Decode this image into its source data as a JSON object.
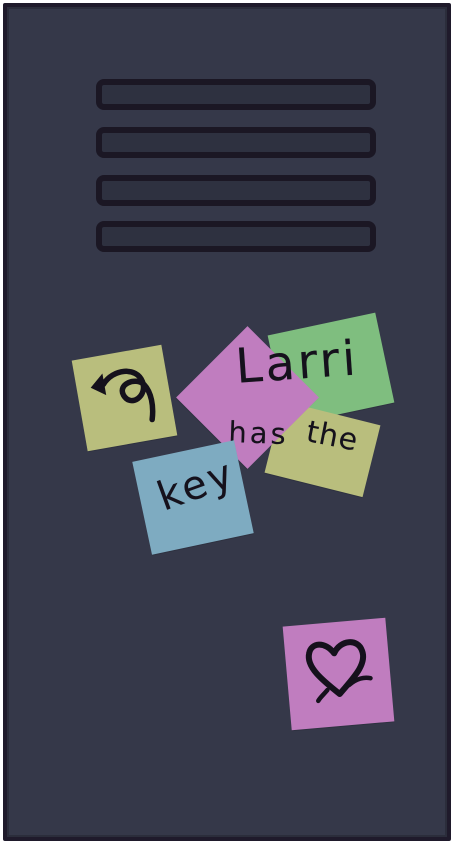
{
  "scene": {
    "notes": {
      "undo": {
        "label": "",
        "icon": "undo-arrow-icon",
        "color": "#b9be7d"
      },
      "larri": {
        "text": "Larri",
        "color": "#c07dbf"
      },
      "green_note": {
        "color": "#7fbe7f"
      },
      "has": {
        "text": "has",
        "color": "#c07dbf"
      },
      "the": {
        "text": "the",
        "color": "#b9be7d"
      },
      "key": {
        "text": "key",
        "color": "#7eabc1"
      },
      "heart": {
        "label": "",
        "icon": "heart-icon",
        "color": "#c07dbf"
      }
    },
    "colors": {
      "locker": "#353849",
      "locker_border": "#1f1a2b",
      "vent": "#2e3140",
      "ink": "#15111c"
    }
  }
}
